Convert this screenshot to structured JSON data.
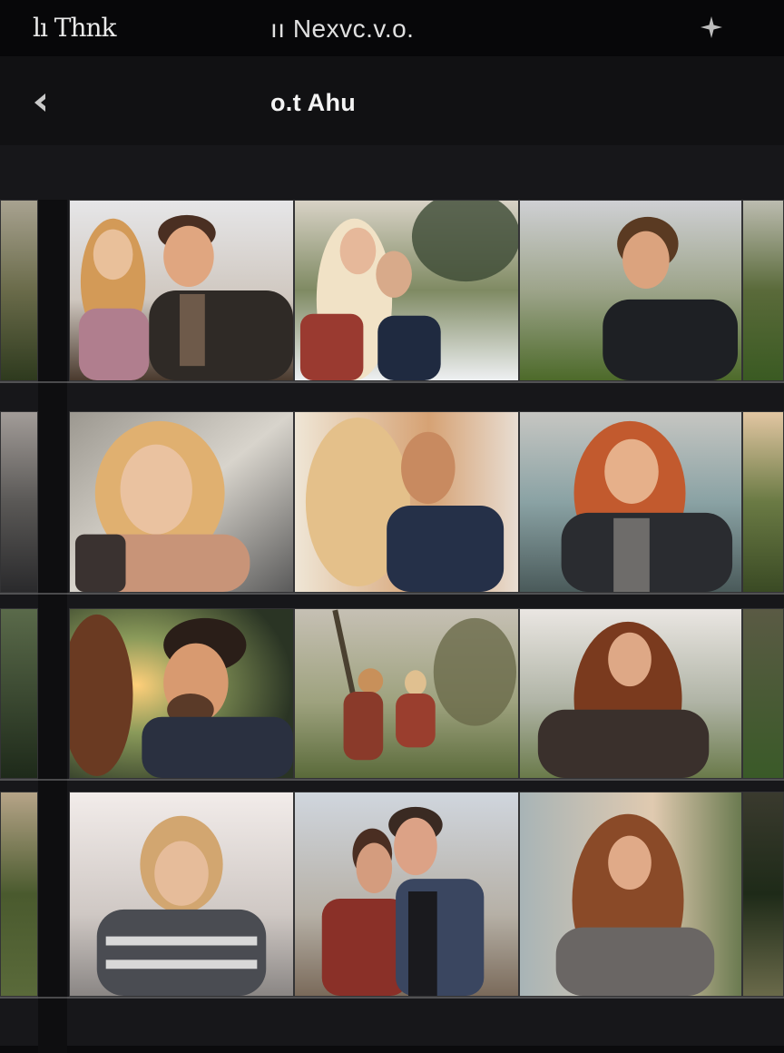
{
  "status_bar": {
    "left_text": "lı Thnk",
    "center_text": "ıı Nexvc.v.o.",
    "right_icon": "sparkle-icon"
  },
  "nav_bar": {
    "back_icon": "chevron-left-icon",
    "title": "o.t Ahu"
  },
  "gallery": {
    "rows": [
      {
        "photos": [
          "edge-photo-meadow",
          "photo-couple-sunset",
          "photo-two-women-beach",
          "photo-curly-man-field",
          "edge-photo-meadow"
        ]
      },
      {
        "photos": [
          "edge-photo-lake",
          "photo-smiling-blonde-woman",
          "photo-couple-backlit",
          "photo-redhead-man-lake",
          "edge-photo-forest"
        ]
      },
      {
        "photos": [
          "edge-photo-field",
          "photo-bearded-man-sunset",
          "photo-two-kids-meadow",
          "photo-long-hair-woman",
          "edge-photo-field"
        ]
      },
      {
        "photos": [
          "edge-photo-grass",
          "photo-woman-striped-sweater",
          "photo-couple-cliff",
          "photo-woman-lake-sunset",
          "edge-photo-forest"
        ]
      }
    ]
  },
  "colors": {
    "background": "#0b0b0d",
    "gallery_bg": "#17171a",
    "nav_bg": "#111113",
    "text": "#f2f2f2"
  }
}
